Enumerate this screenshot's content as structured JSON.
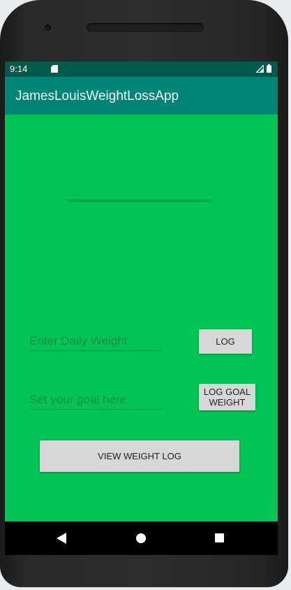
{
  "status_bar": {
    "time": "9:14",
    "icons": [
      "sd-card-icon",
      "signal-icon",
      "battery-icon"
    ]
  },
  "app_bar": {
    "title": "JamesLouisWeightLossApp"
  },
  "form": {
    "daily_weight_placeholder": "Enter Daily Weight",
    "log_button": "LOG",
    "goal_placeholder": "Set your goal here",
    "log_goal_button": "LOG GOAL\nWEIGHT",
    "view_log_button": "VIEW WEIGHT LOG"
  },
  "nav_bar": {
    "icons": [
      "back-icon",
      "home-icon",
      "recents-icon"
    ]
  },
  "colors": {
    "background": "#00c555",
    "app_bar": "#008577",
    "status_bar": "#015b4d",
    "button": "#d7d7d7"
  }
}
